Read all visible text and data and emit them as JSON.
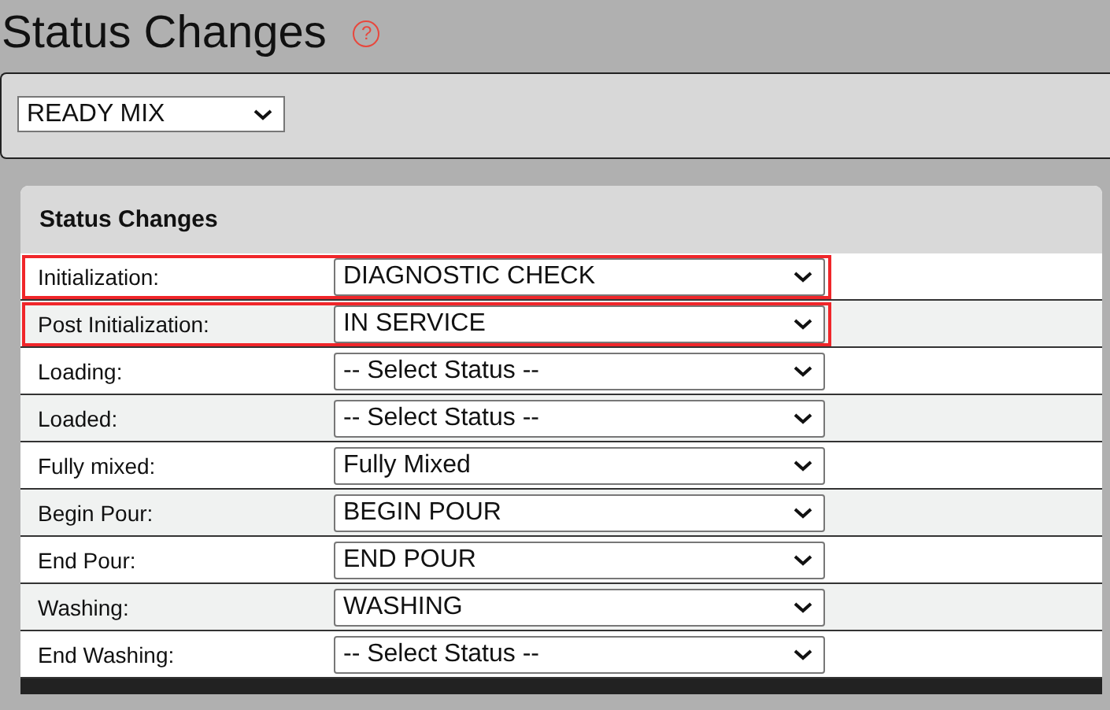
{
  "page": {
    "title": "Status Changes",
    "help_icon": "?"
  },
  "filter": {
    "value": "READY MIX"
  },
  "card": {
    "title": "Status Changes",
    "rows": [
      {
        "label": "Initialization:",
        "value": "DIAGNOSTIC CHECK",
        "highlighted": true
      },
      {
        "label": "Post Initialization:",
        "value": "IN SERVICE",
        "highlighted": true
      },
      {
        "label": "Loading:",
        "value": "-- Select Status --",
        "highlighted": false
      },
      {
        "label": "Loaded:",
        "value": "-- Select Status --",
        "highlighted": false
      },
      {
        "label": "Fully mixed:",
        "value": "Fully Mixed",
        "highlighted": false
      },
      {
        "label": "Begin Pour:",
        "value": "BEGIN POUR",
        "highlighted": false
      },
      {
        "label": "End Pour:",
        "value": "END POUR",
        "highlighted": false
      },
      {
        "label": "Washing:",
        "value": "WASHING",
        "highlighted": false
      },
      {
        "label": "End Washing:",
        "value": "-- Select Status --",
        "highlighted": false
      }
    ]
  }
}
